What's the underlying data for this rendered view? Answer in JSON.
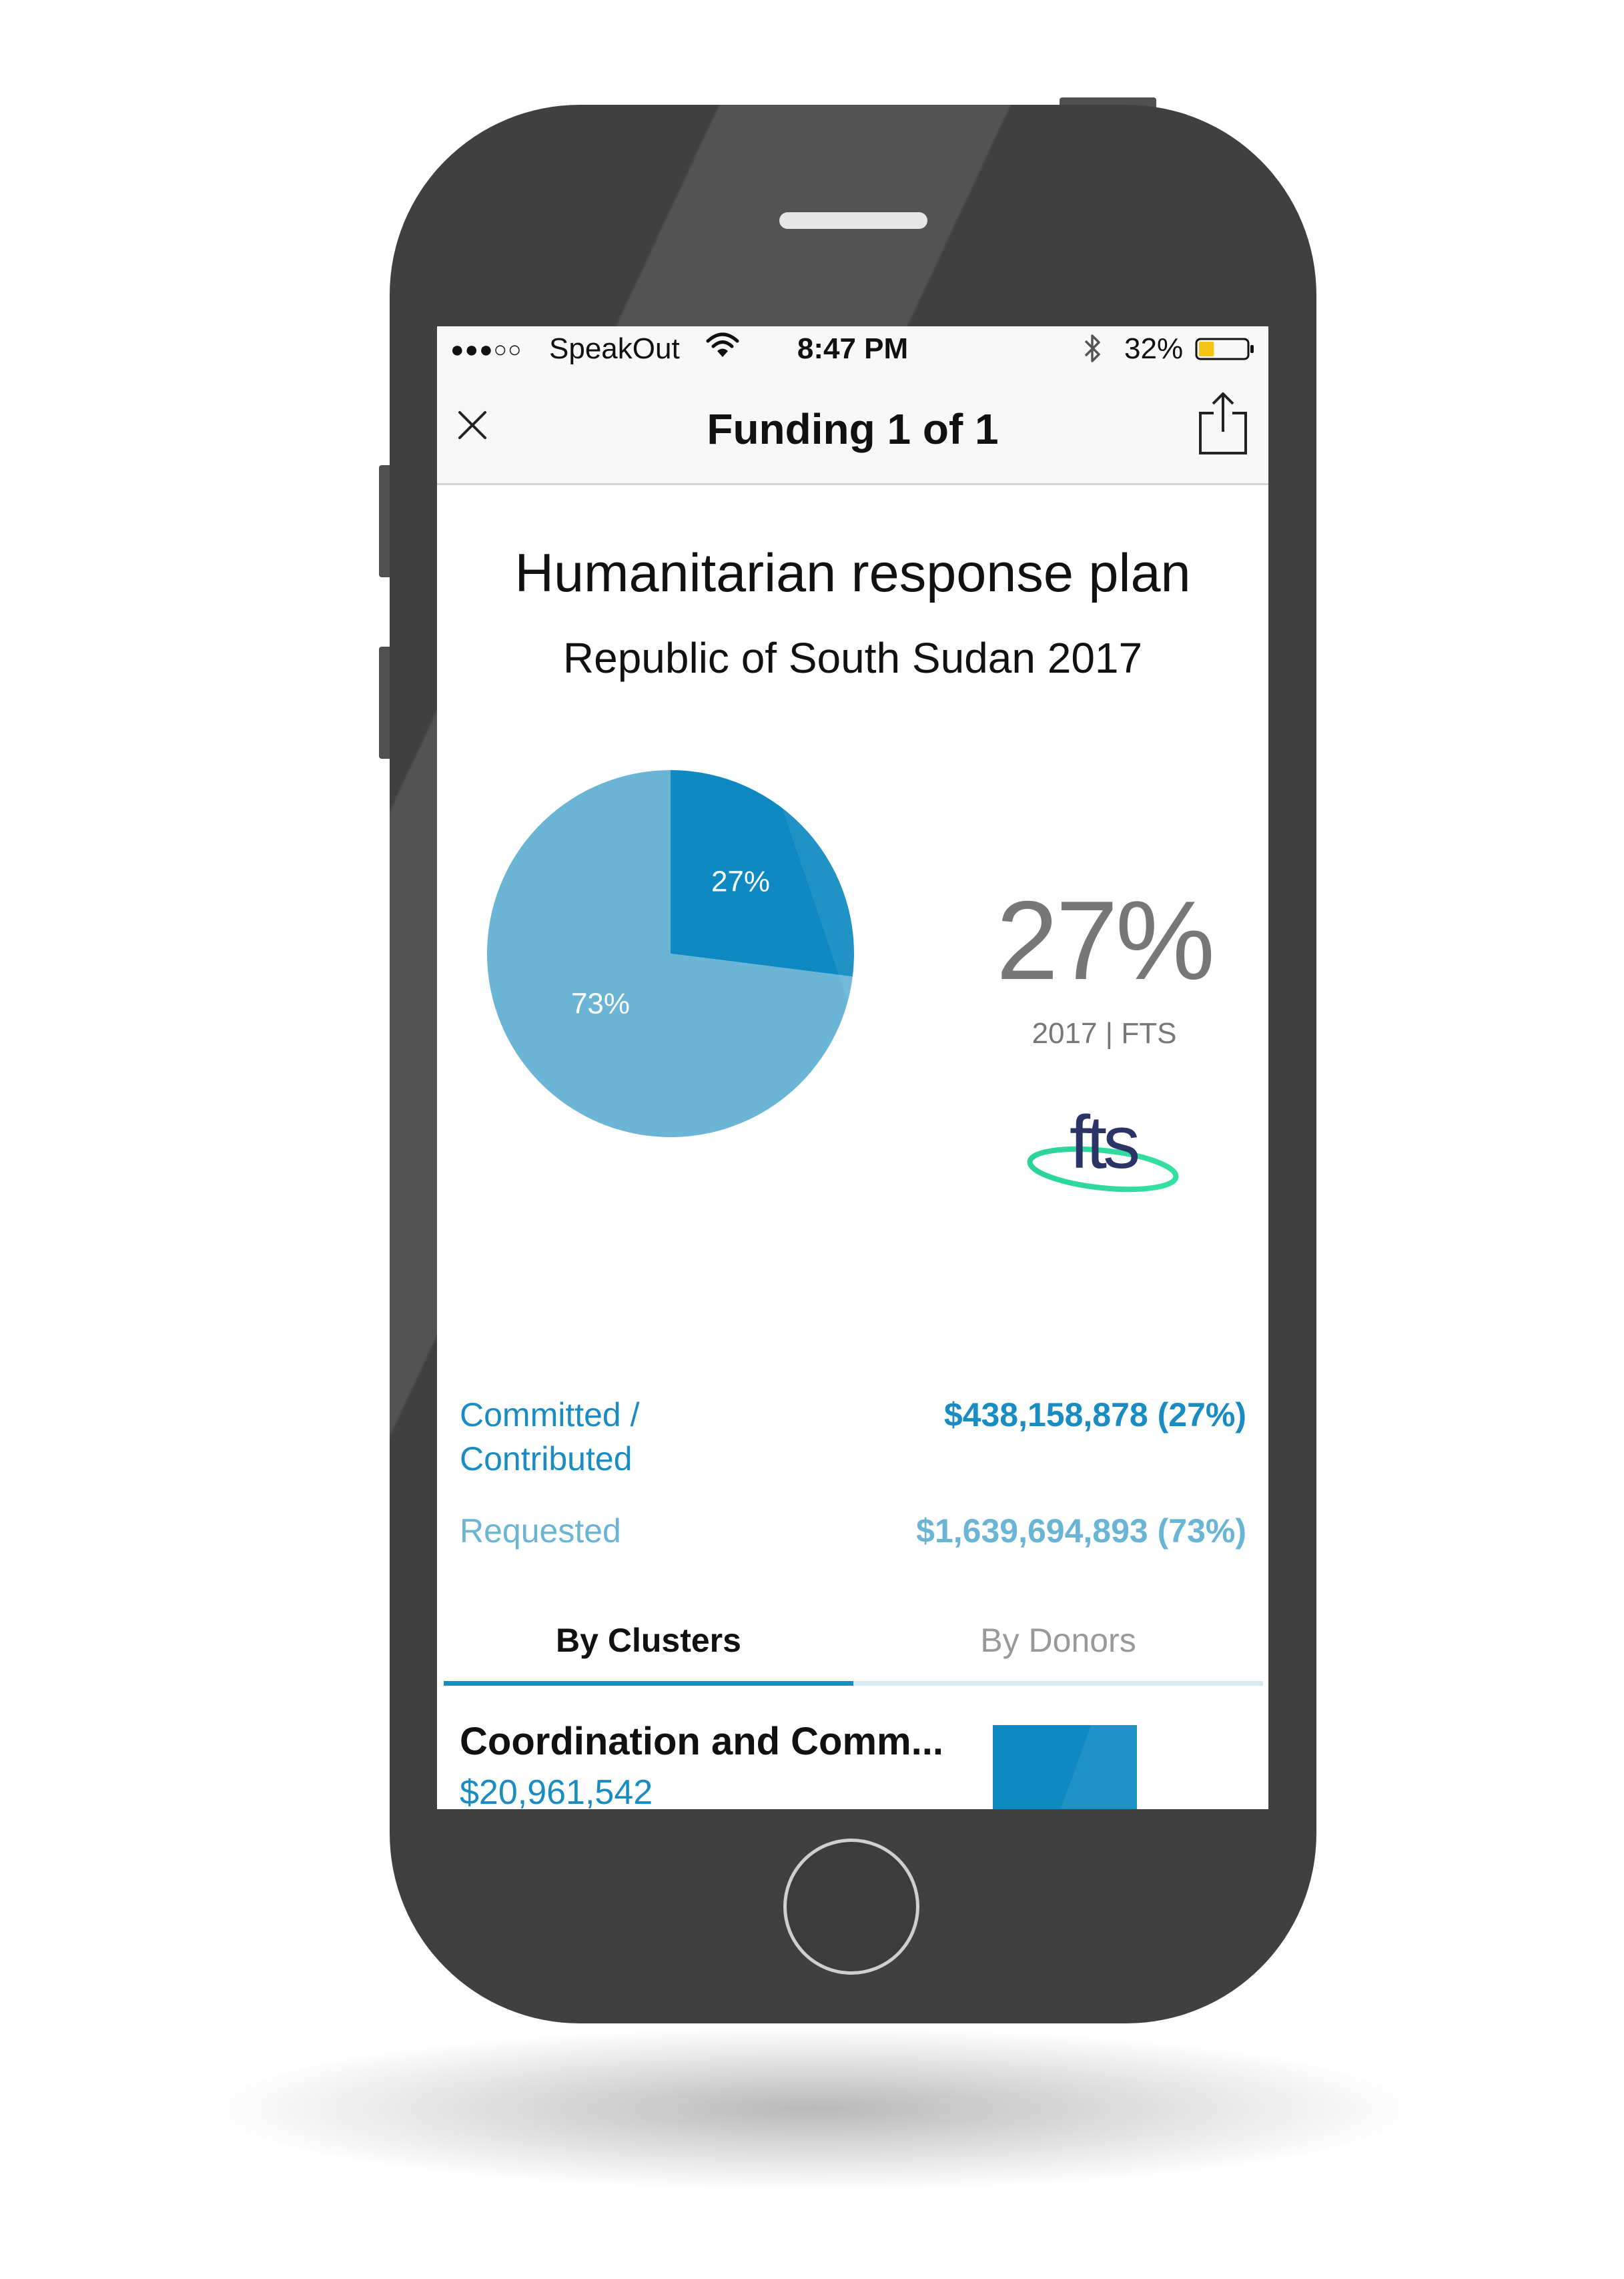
{
  "status_bar": {
    "signal_dots": "●●●○○",
    "carrier": "SpeakOut",
    "time": "8:47 PM",
    "battery_percent": "32%",
    "battery_level": 0.32
  },
  "nav_bar": {
    "title": "Funding 1 of 1",
    "close_icon": "close-icon",
    "share_icon": "share-icon"
  },
  "plan": {
    "title": "Humanitarian response plan",
    "subtitle": "Republic of South Sudan 2017"
  },
  "summary": {
    "big_percent": "27%",
    "source_caption": "2017 | FTS",
    "logo_text": "fts"
  },
  "legend": {
    "committed_label": "Committed / Contributed",
    "committed_value": "$438,158,878 (27%)",
    "requested_label": "Requested",
    "requested_value": "$1,639,694,893 (73%)"
  },
  "tabs": {
    "active": "By Clusters",
    "inactive": "By Donors"
  },
  "clusters": [
    {
      "name": "Coordination and Comm...",
      "amount": "$20,961,542"
    }
  ],
  "chart_data": {
    "type": "pie",
    "slices": [
      {
        "label": "27%",
        "value": 27,
        "color": "#0e89c2"
      },
      {
        "label": "73%",
        "value": 73,
        "color": "#6ab4d6"
      }
    ]
  },
  "colors": {
    "accent": "#1a8cc4",
    "requested": "#6ab4d6",
    "phone_body": "#404040"
  }
}
